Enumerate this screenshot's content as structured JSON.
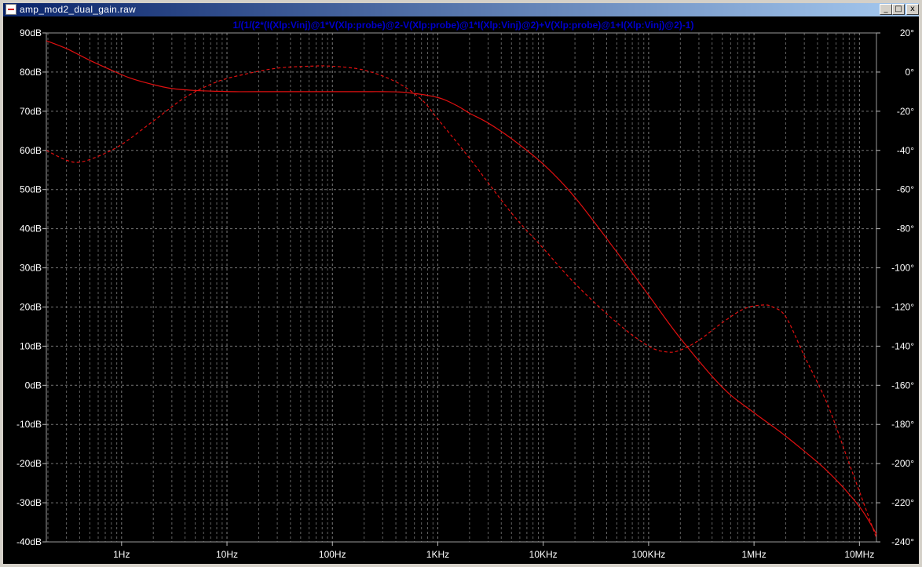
{
  "window": {
    "title": "amp_mod2_dual_gain.raw",
    "minimize_glyph": "_",
    "maximize_glyph": "□",
    "close_glyph": "x"
  },
  "chart_data": {
    "type": "line",
    "title": "1/(1/(2*(I(Xlp:Vinj)@1*V(Xlp:probe)@2-V(Xlp:probe)@1*I(Xlp:Vinj)@2)+V(Xlp:probe)@1+I(Xlp:Vinj)@2)-1)",
    "title_color": "#0000cc",
    "trace_color": "#e01010",
    "background": "#000000",
    "grid": true,
    "x_scale": "log",
    "xlim_hz": [
      0.1933,
      14500000
    ],
    "x_tick_values": [
      1,
      10,
      100,
      1000,
      10000,
      100000,
      1000000,
      10000000
    ],
    "x_tick_labels": [
      "1Hz",
      "10Hz",
      "100Hz",
      "1KHz",
      "10KHz",
      "100KHz",
      "1MHz",
      "10MHz"
    ],
    "left_axis": {
      "unit": "dB",
      "ylim": [
        -40,
        90
      ],
      "tick_values": [
        90,
        80,
        70,
        60,
        50,
        40,
        30,
        20,
        10,
        0,
        -10,
        -20,
        -30,
        -40
      ],
      "tick_labels": [
        "90dB",
        "80dB",
        "70dB",
        "60dB",
        "50dB",
        "40dB",
        "30dB",
        "20dB",
        "10dB",
        "0dB",
        "-10dB",
        "-20dB",
        "-30dB",
        "-40dB"
      ]
    },
    "right_axis": {
      "unit": "°",
      "ylim": [
        -240,
        20
      ],
      "tick_values": [
        20,
        0,
        -20,
        -40,
        -60,
        -80,
        -100,
        -120,
        -140,
        -160,
        -180,
        -200,
        -220,
        -240
      ],
      "tick_labels": [
        "20°",
        "0°",
        "-20°",
        "-40°",
        "-60°",
        "-80°",
        "-100°",
        "-120°",
        "-140°",
        "-160°",
        "-180°",
        "-200°",
        "-220°",
        "-240°"
      ]
    },
    "series": [
      {
        "quantity": "magnitude",
        "axis": "left",
        "line_style": "solid",
        "x": [
          0.1933,
          0.3,
          0.5,
          0.8,
          1.2,
          2,
          3,
          5,
          8,
          12,
          20,
          50,
          100,
          200,
          300,
          500,
          1000,
          1500,
          2000,
          3000,
          5000,
          10000,
          20000,
          50000,
          100000,
          200000,
          500000,
          1000000,
          2000000,
          5000000,
          10000000,
          14500000
        ],
        "y": [
          88,
          86,
          83,
          80.5,
          78.5,
          76.8,
          75.8,
          75.3,
          75.1,
          75,
          75,
          75,
          75,
          75,
          75,
          74.8,
          73.5,
          71.5,
          69.5,
          67,
          63,
          56.5,
          48,
          34,
          23,
          12,
          -0.5,
          -7,
          -13,
          -22,
          -31,
          -38
        ]
      },
      {
        "quantity": "phase",
        "axis": "right",
        "line_style": "dashed",
        "x": [
          0.1933,
          0.3,
          0.4,
          0.6,
          1,
          2,
          4,
          8,
          15,
          30,
          60,
          100,
          200,
          400,
          700,
          1000,
          2000,
          5000,
          10000,
          20000,
          50000,
          100000,
          150000,
          200000,
          300000,
          500000,
          800000,
          1200000,
          1500000,
          2000000,
          3000000,
          5000000,
          8000000,
          14500000
        ],
        "y": [
          -40,
          -45,
          -46,
          -43,
          -37,
          -25,
          -13,
          -5,
          -1,
          2,
          3,
          3,
          1,
          -5,
          -14,
          -24,
          -44,
          -72,
          -90,
          -108,
          -128,
          -140,
          -143,
          -142,
          -137,
          -128,
          -121,
          -119,
          -120,
          -125,
          -145,
          -170,
          -200,
          -238
        ]
      }
    ]
  }
}
